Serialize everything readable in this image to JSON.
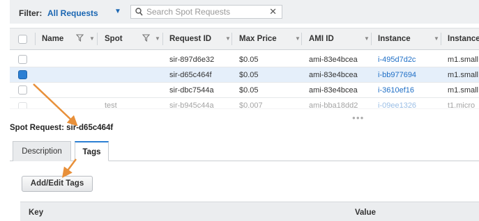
{
  "filter": {
    "label": "Filter:",
    "value": "All Requests",
    "search_placeholder": "Search Spot Requests"
  },
  "icons": {
    "chevron": "chevron-down-icon",
    "search": "search-icon",
    "clear": "close-icon",
    "filter": "filter-icon",
    "sort": "sort-arrow-icon",
    "accent": "#e8903a"
  },
  "table": {
    "columns": [
      "Name",
      "Spot",
      "Request ID",
      "Max Price",
      "AMI ID",
      "Instance",
      "Instance"
    ],
    "rows": [
      {
        "name": "",
        "request_id": "sir-897d6e32",
        "max_price": "$0.05",
        "ami_id": "ami-83e4bcea",
        "instance": "i-495d7d2c",
        "type": "m1.small",
        "selected": false
      },
      {
        "name": "",
        "request_id": "sir-d65c464f",
        "max_price": "$0.05",
        "ami_id": "ami-83e4bcea",
        "instance": "i-bb977694",
        "type": "m1.small",
        "selected": true
      },
      {
        "name": "",
        "request_id": "sir-dbc7544a",
        "max_price": "$0.05",
        "ami_id": "ami-83e4bcea",
        "instance": "i-3610ef16",
        "type": "m1.small",
        "selected": false
      },
      {
        "name": "test",
        "request_id": "sir-b945c44a",
        "max_price": "$0.007",
        "ami_id": "ami-bba18dd2",
        "instance": "i-09ee1326",
        "type": "t1.micro",
        "selected": false
      }
    ]
  },
  "detail": {
    "title": "Spot Request: sir-d65c464f",
    "tabs": [
      "Description",
      "Tags"
    ],
    "active_tab": "Tags",
    "button": "Add/Edit Tags",
    "kv_headers": [
      "Key",
      "Value"
    ]
  },
  "colors": {
    "link": "#1f6fc6",
    "selection": "#e5effa",
    "annotation_arrow": "#e8903a"
  }
}
